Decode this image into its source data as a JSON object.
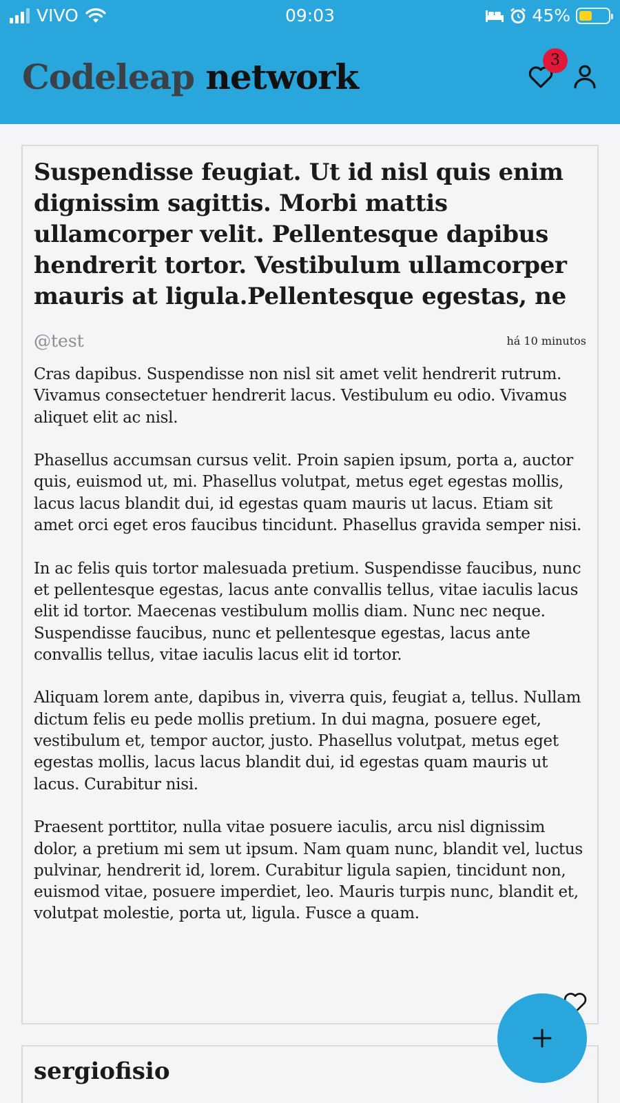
{
  "status_bar": {
    "carrier": "VIVO",
    "time": "09:03",
    "battery": "45%",
    "battery_level": 0.45
  },
  "header": {
    "brand_part1": "Codeleap",
    "brand_part2": "network",
    "notification_count": "3"
  },
  "posts": [
    {
      "title": "Suspendisse feugiat. Ut id nisl quis enim dignissim sagittis. Morbi mattis ullamcorper velit. Pellentesque dapibus hendrerit tortor. Vestibulum ullamcorper mauris at ligula.Pellentesque egestas, ne",
      "username": "@test",
      "time_ago": "há 10 minutos",
      "paragraphs": [
        "Cras dapibus. Suspendisse non nisl sit amet velit hendrerit rutrum. Vivamus consectetuer hendrerit lacus. Vestibulum eu odio. Vivamus aliquet elit ac nisl.",
        "Phasellus accumsan cursus velit. Proin sapien ipsum, porta a, auctor quis, euismod ut, mi. Phasellus volutpat, metus eget egestas mollis, lacus lacus blandit dui, id egestas quam mauris ut lacus. Etiam sit amet orci eget eros faucibus tincidunt. Phasellus gravida semper nisi.",
        "In ac felis quis tortor malesuada pretium. Suspendisse faucibus, nunc et pellentesque egestas, lacus ante convallis tellus, vitae iaculis lacus elit id tortor. Maecenas vestibulum mollis diam. Nunc nec neque. Suspendisse faucibus, nunc et pellentesque egestas, lacus ante convallis tellus, vitae iaculis lacus elit id tortor.",
        "Aliquam lorem ante, dapibus in, viverra quis, feugiat a, tellus. Nullam dictum felis eu pede mollis pretium. In dui magna, posuere eget, vestibulum et, tempor auctor, justo. Phasellus volutpat, metus eget egestas mollis, lacus lacus blandit dui, id egestas quam mauris ut lacus. Curabitur nisi.",
        "Praesent porttitor, nulla vitae posuere iaculis, arcu nisl dignissim dolor, a pretium mi sem ut ipsum. Nam quam nunc, blandit vel, luctus pulvinar, hendrerit id, lorem. Curabitur ligula sapien, tincidunt non, euismod vitae, posuere imperdiet, leo. Mauris turpis nunc, blandit et, volutpat molestie, porta ut, ligula. Fusce a quam."
      ]
    },
    {
      "title": "sergiofisio"
    }
  ],
  "icons": {
    "fab": "plus-icon",
    "favorites": "heart-icon",
    "profile": "user-icon",
    "like": "heart-outline-icon"
  },
  "colors": {
    "header": "#29a6dc",
    "badge": "#e2183a",
    "battery": "#ffd21f"
  }
}
